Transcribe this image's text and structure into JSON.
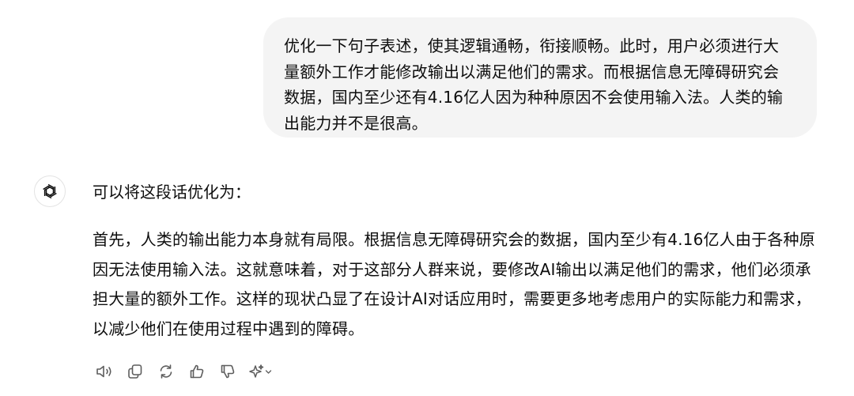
{
  "conversation": {
    "user_message": "优化一下句子表述，使其逻辑通畅，衔接顺畅。此时，用户必须进行大量额外工作才能修改输出以满足他们的需求。而根据信息无障碍研究会数据，国内至少还有4.16亿人因为种种原因不会使用输入法。人类的输出能力并不是很高。",
    "assistant_avatar_icon": "openai-logo-icon",
    "assistant_intro": "可以将这段话优化为：",
    "assistant_body": "首先，人类的输出能力本身就有局限。根据信息无障碍研究会的数据，国内至少有4.16亿人由于各种原因无法使用输入法。这就意味着，对于这部分人群来说，要修改AI输出以满足他们的需求，他们必须承担大量的额外工作。这样的现状凸显了在设计AI对话应用时，需要更多地考虑用户的实际能力和需求，以减少他们在使用过程中遇到的障碍。"
  },
  "actions": [
    {
      "icon": "speaker-icon"
    },
    {
      "icon": "copy-icon"
    },
    {
      "icon": "regenerate-icon"
    },
    {
      "icon": "thumbs-up-icon"
    },
    {
      "icon": "thumbs-down-icon"
    },
    {
      "icon": "sparkle-model-icon"
    }
  ],
  "colors": {
    "user_bubble_bg": "#f4f4f4",
    "text": "#0d0d0d",
    "icon": "#5d5d5d"
  }
}
